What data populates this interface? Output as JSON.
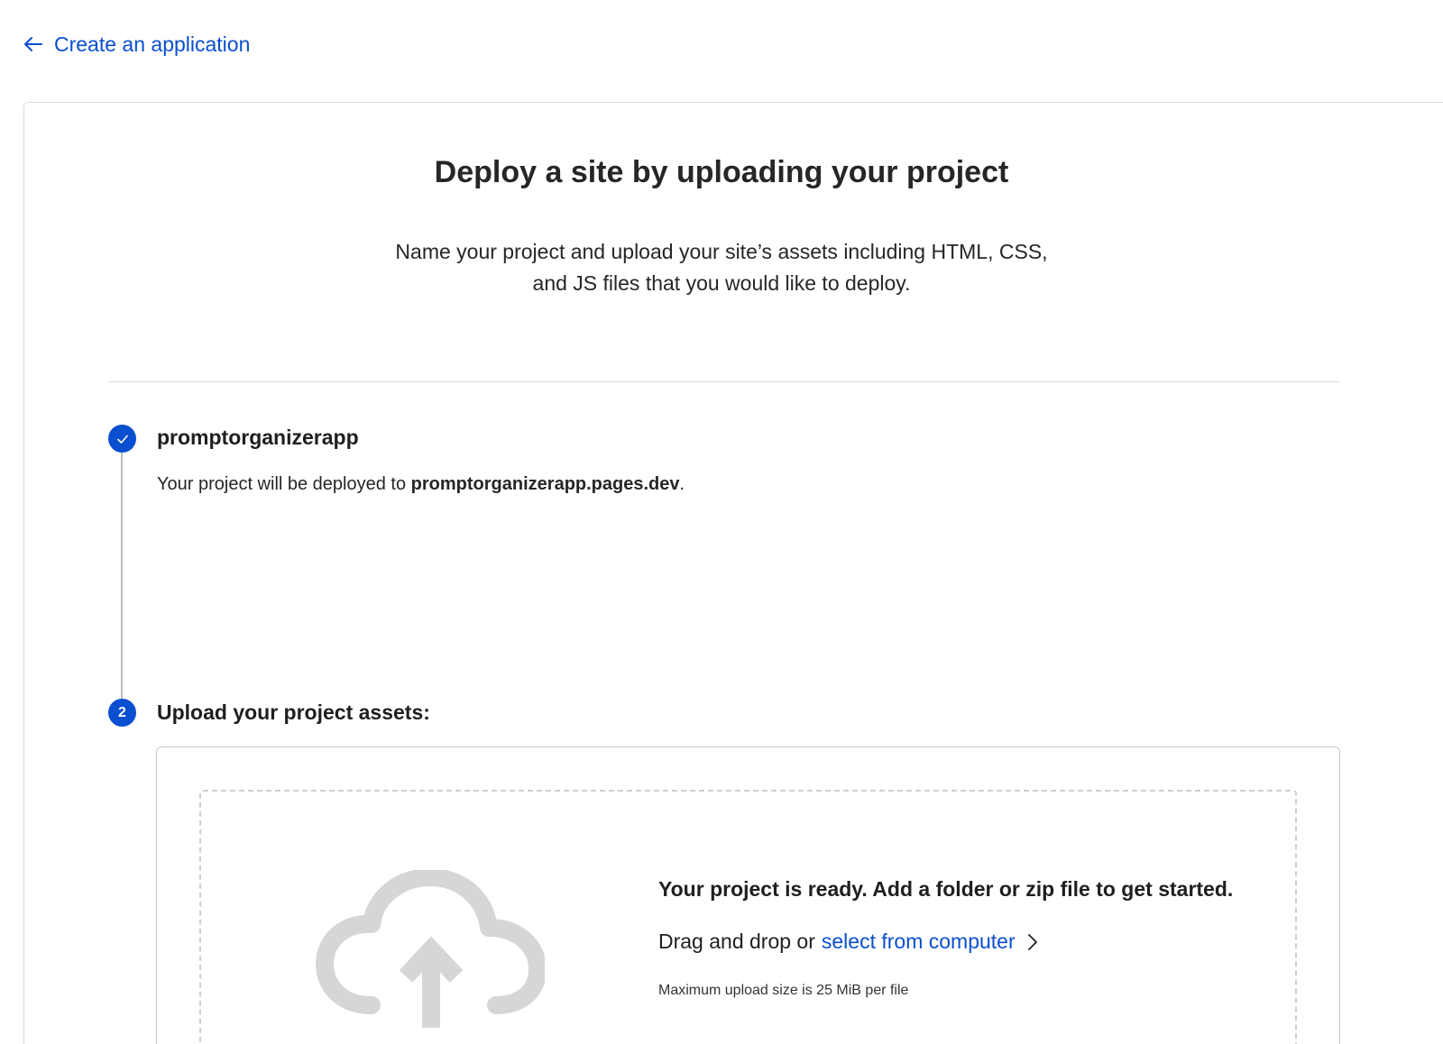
{
  "nav": {
    "back_label": "Create an application"
  },
  "header": {
    "title": "Deploy a site by uploading your project",
    "subtitle_line1": "Name your project and upload your site’s assets including HTML, CSS,",
    "subtitle_line2": "and JS files that you would like to deploy."
  },
  "steps": [
    {
      "status": "complete",
      "marker_icon": "check-icon",
      "title": "promptorganizerapp",
      "desc_prefix": "Your project will be deployed to ",
      "desc_domain": "promptorganizerapp.pages.dev",
      "desc_suffix": "."
    },
    {
      "status": "active",
      "number": "2",
      "title": "Upload your project assets:"
    }
  ],
  "upload": {
    "icon": "cloud-upload-icon",
    "ready_text": "Your project is ready. Add a folder or zip file to get started.",
    "drag_text": "Drag and drop or",
    "select_link": "select from computer",
    "max_size": "Maximum upload size is 25 MiB per file"
  },
  "colors": {
    "accent": "#0b4fd1",
    "link": "#0a4fd1",
    "icon_gray": "#d6d6d6",
    "border": "#d9d9d9"
  }
}
